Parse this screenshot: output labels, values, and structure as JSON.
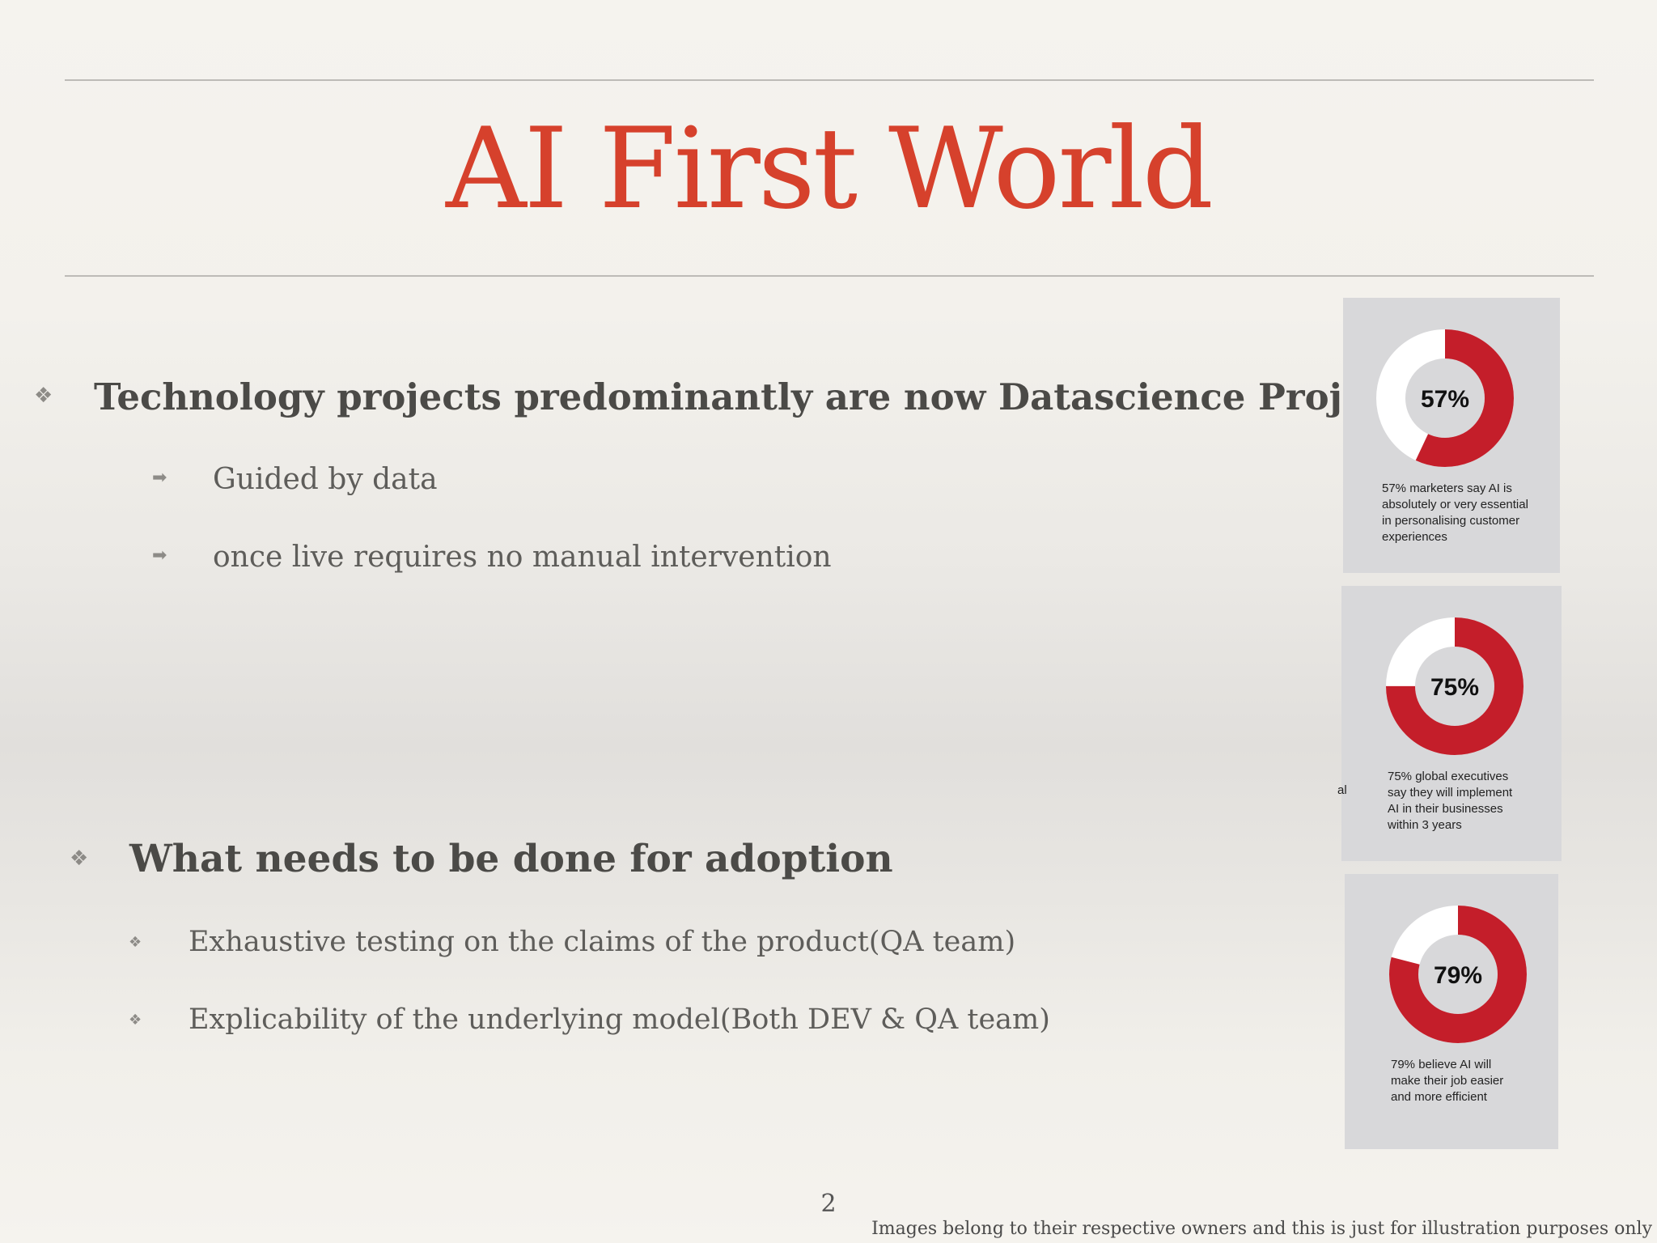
{
  "slide": {
    "title": "AI First World",
    "page_number": "2",
    "footer_note": "Images belong to their respective owners and this is just for illustration  purposes only"
  },
  "section1": {
    "heading": "Technology projects predominantly are now Datascience Projects",
    "items": [
      "Guided by data",
      "once live requires no manual intervention"
    ]
  },
  "section2": {
    "heading": "What needs to be done for adoption",
    "items": [
      "Exhaustive testing on the claims of the product(QA team)",
      "Explicability of the underlying model(Both DEV & QA team)"
    ]
  },
  "stray_text": "al",
  "colors": {
    "title": "#d6412c",
    "donut_fill": "#c41e2a",
    "donut_rest": "#ffffff",
    "card_bg": "#d8d8da"
  },
  "icons": {
    "main_bullet": "diamond-bullet-icon",
    "sub_bullet_section1": "arrow-bullet-icon",
    "sub_bullet_section2": "diamond-bullet-icon"
  },
  "chart_data": [
    {
      "type": "pie",
      "variant": "donut",
      "center_label": "57%",
      "values": [
        57,
        43
      ],
      "caption": "57% marketers say AI is\nabsolutely or very essential\nin personalising customer\nexperiences"
    },
    {
      "type": "pie",
      "variant": "donut",
      "center_label": "75%",
      "values": [
        75,
        25
      ],
      "caption": "75% global executives\nsay they will implement\nAI in their businesses\nwithin 3 years"
    },
    {
      "type": "pie",
      "variant": "donut",
      "center_label": "79%",
      "values": [
        79,
        21
      ],
      "caption": "79% believe AI will\nmake their job easier\nand more efficient"
    }
  ]
}
